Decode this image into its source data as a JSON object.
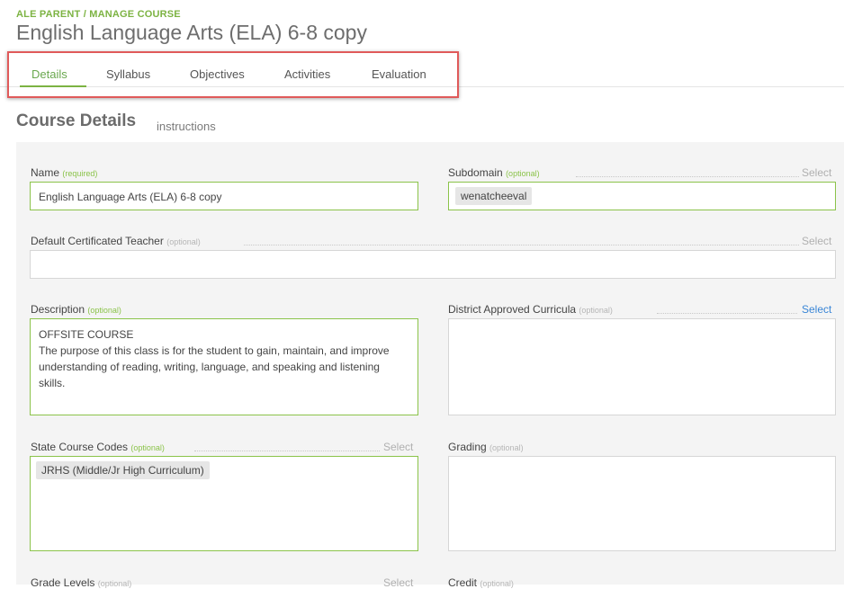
{
  "header": {
    "breadcrumb": "ALE PARENT / MANAGE COURSE",
    "title": "English Language Arts (ELA) 6-8 copy"
  },
  "tabs": [
    {
      "label": "Details",
      "active": true
    },
    {
      "label": "Syllabus"
    },
    {
      "label": "Objectives"
    },
    {
      "label": "Activities"
    },
    {
      "label": "Evaluation"
    }
  ],
  "section": {
    "title": "Course Details",
    "subtitle": "instructions"
  },
  "form": {
    "select_label": "Select",
    "name": {
      "label": "Name",
      "hint": "(required)",
      "value": "English Language Arts (ELA) 6-8 copy"
    },
    "subdomain": {
      "label": "Subdomain",
      "hint": "(optional)",
      "value": "wenatcheeval"
    },
    "teacher": {
      "label": "Default Certificated Teacher",
      "hint": "(optional)",
      "value": ""
    },
    "description": {
      "label": "Description",
      "hint": "(optional)",
      "value": "OFFSITE COURSE\nThe purpose of this class is for the student to gain, maintain, and improve understanding of reading, writing, language, and speaking and listening skills."
    },
    "curricula": {
      "label": "District Approved Curricula",
      "hint": "(optional)",
      "value": ""
    },
    "state_codes": {
      "label": "State Course Codes",
      "hint": "(optional)",
      "value": "JRHS (Middle/Jr High Curriculum)"
    },
    "grading": {
      "label": "Grading",
      "hint": "(optional)",
      "value": ""
    },
    "grade_levels": {
      "label": "Grade Levels",
      "hint": "(optional)"
    },
    "credit": {
      "label": "Credit",
      "hint": "(optional)"
    }
  },
  "colors": {
    "accent_green": "#7cb342",
    "highlight_red": "#e05a5a",
    "link_blue": "#3a86d6"
  }
}
